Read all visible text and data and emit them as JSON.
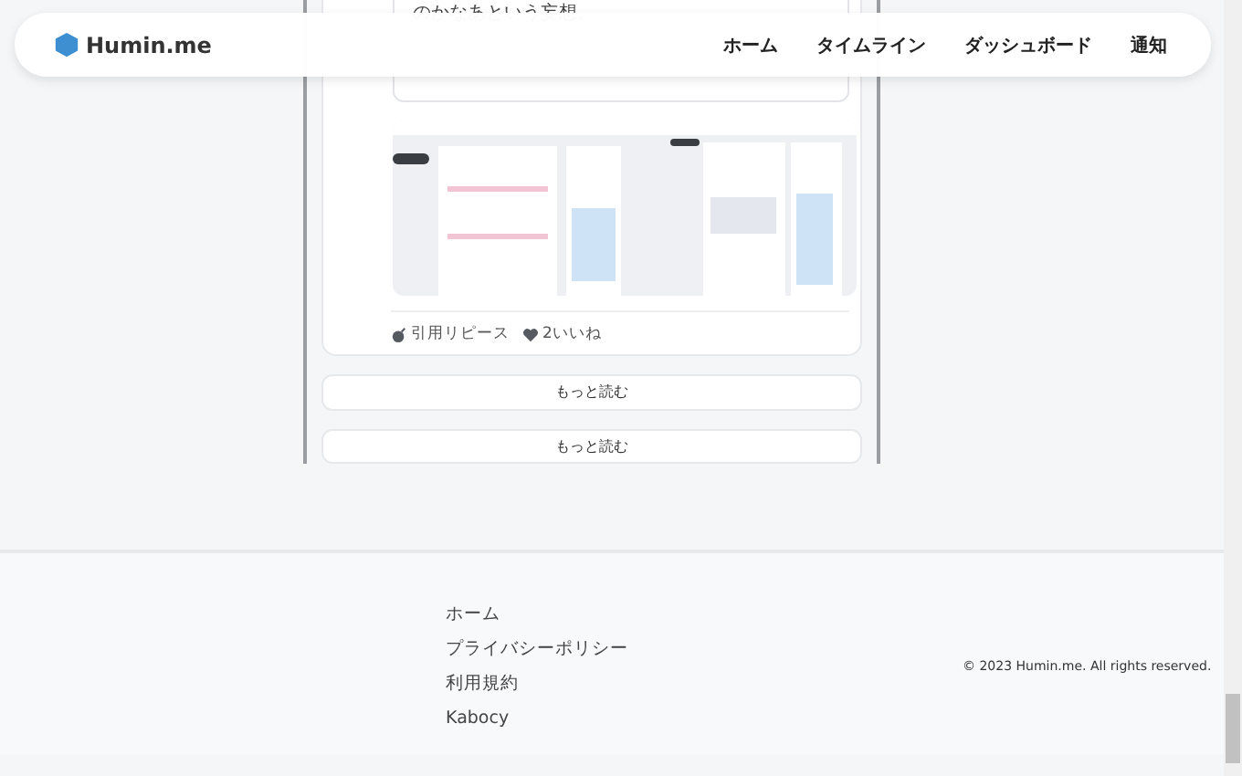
{
  "header": {
    "logo": "Humin.me",
    "nav": [
      {
        "label": "ホーム"
      },
      {
        "label": "タイムライン"
      },
      {
        "label": "ダッシュボード"
      },
      {
        "label": "通知"
      }
    ]
  },
  "post": {
    "quote_text": "のかなあという妄想。",
    "actions": [
      {
        "kind": "repost",
        "label": "引用リピース"
      },
      {
        "kind": "like",
        "label": "2いいね"
      }
    ]
  },
  "more_buttons": [
    "もっと読む",
    "もっと読む"
  ],
  "footer": {
    "links": [
      "ホーム",
      "プライバシーポリシー",
      "利用規約",
      "Kabocy"
    ],
    "copyright": "© 2023 Humin.me. All rights reserved."
  }
}
